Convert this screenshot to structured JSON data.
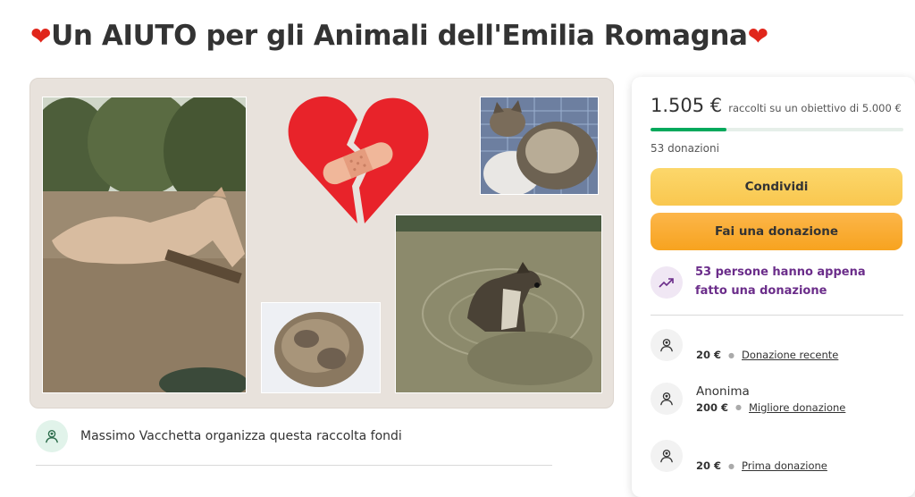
{
  "page": {
    "title": "Un AIUTO per gli Animali dell'Emilia Romagna",
    "title_emoji": "❤"
  },
  "collage": {
    "images": [
      {
        "id": "horse",
        "icon": "horse-in-flood-photo"
      },
      {
        "id": "broken-heart",
        "icon": "broken-heart-bandage-icon"
      },
      {
        "id": "muddy-cat",
        "icon": "muddy-cat-photo"
      },
      {
        "id": "hedgehog",
        "icon": "muddy-hedgehog-photo"
      },
      {
        "id": "dog",
        "icon": "dog-in-flood-photo"
      }
    ]
  },
  "organizer": {
    "text": "Massimo Vacchetta organizza questa raccolta fondi",
    "icon": "heart-hand-icon"
  },
  "sidebar": {
    "raised": "1.505 €",
    "goal_text": "raccolti su un obiettivo di 5.000 €",
    "progress_fraction": 0.301,
    "donations_count": "53 donazioni",
    "share_label": "Condividi",
    "donate_label": "Fai una donazione",
    "recent_activity": "53 persone hanno appena fatto una donazione",
    "donations": [
      {
        "name": "",
        "amount": "20 €",
        "tag": "Donazione recente"
      },
      {
        "name": "Anonima",
        "amount": "200 €",
        "tag": "Migliore donazione"
      },
      {
        "name": "",
        "amount": "20 €",
        "tag": "Prima donazione"
      }
    ]
  },
  "colors": {
    "progress": "#02a95c",
    "share_button": "#f9c74f",
    "donate_button": "#f7a31f",
    "accent_purple": "#6b2d8a",
    "heart": "#e0261b"
  }
}
